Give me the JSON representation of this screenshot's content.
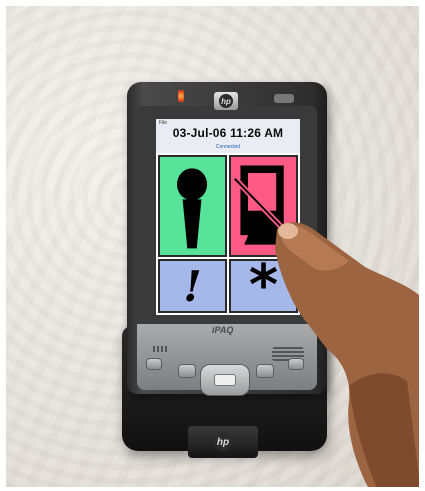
{
  "device": {
    "brand_logo": "hp",
    "model_label": "iPAQ",
    "badge_logo": "hp"
  },
  "screen": {
    "menu_label": "File",
    "datetime": "03-Jul-06  11:26 AM",
    "status": "Connected",
    "tiles": [
      {
        "icon": "microphone-icon",
        "color": "#58e39a"
      },
      {
        "icon": "microphone-muted-icon",
        "color": "#ff5a86"
      },
      {
        "label": "!",
        "icon": "exclamation-icon",
        "color": "#a6b8ea"
      },
      {
        "label": "*",
        "icon": "asterisk-icon",
        "color": "#a6b8ea"
      }
    ]
  },
  "colors": {
    "wall": "#e6e2dc",
    "device_body": "#2e2e2e",
    "title_text": "#0a0a0a",
    "status_text": "#1f5fb0"
  }
}
